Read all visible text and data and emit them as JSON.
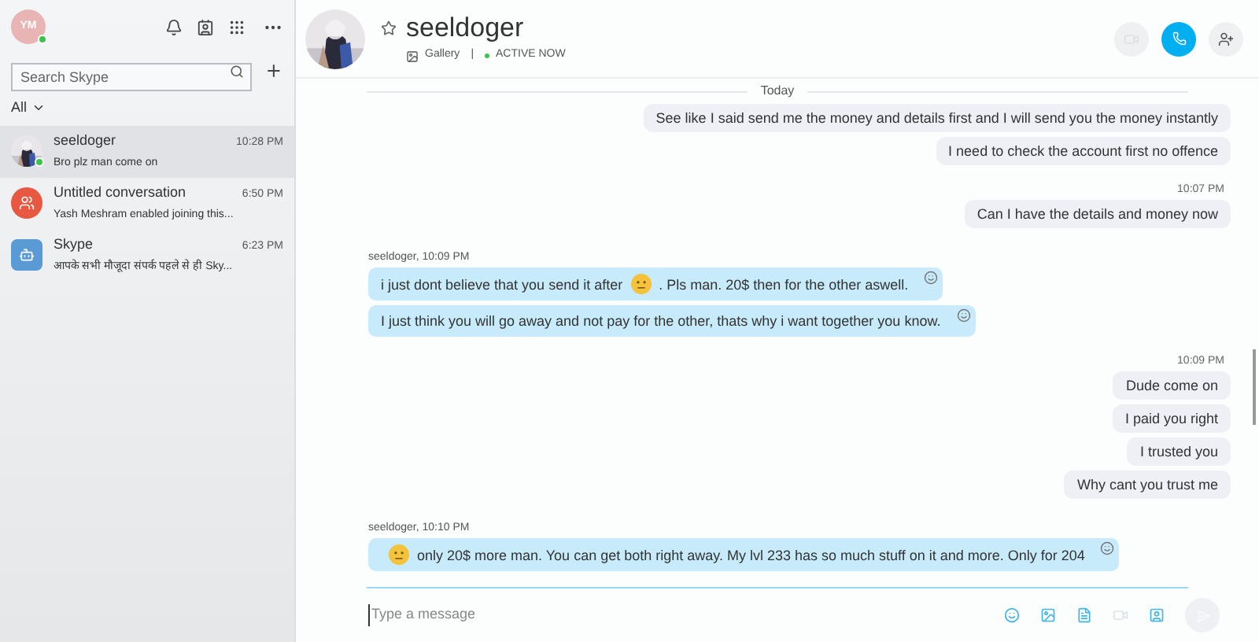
{
  "profile": {
    "initials": "YM",
    "online": true
  },
  "search": {
    "placeholder": "Search Skype"
  },
  "filter": {
    "label": "All"
  },
  "chats": [
    {
      "name": "seeldoger",
      "time": "10:28 PM",
      "preview": "Bro plz man come on",
      "kind": "picture",
      "online": true,
      "selected": true
    },
    {
      "name": "Untitled conversation",
      "time": "6:50 PM",
      "preview": "Yash Meshram enabled joining this...",
      "kind": "group",
      "color": "#e8573f",
      "online": false,
      "selected": false
    },
    {
      "name": "Skype",
      "time": "6:23 PM",
      "preview": "आपके सभी मौजूदा संपर्क पहले से ही Sky...",
      "kind": "bot",
      "color": "#5a9bd5",
      "online": false,
      "selected": false
    }
  ],
  "conversation": {
    "name": "seeldoger",
    "gallery": "Gallery",
    "separator": "|",
    "status": "ACTIVE NOW",
    "video_enabled": false
  },
  "messages": [
    {
      "kind": "date",
      "text": "Today"
    },
    {
      "kind": "outgoing",
      "text": "See like I said send me the money and details first and I will send you the money instantly"
    },
    {
      "kind": "outgoing",
      "text": "I need to check the account first no offence"
    },
    {
      "kind": "time",
      "text": "10:07 PM"
    },
    {
      "kind": "outgoing",
      "text": "Can I have the details and money now"
    },
    {
      "kind": "sender",
      "text": "seeldoger,  10:09 PM"
    },
    {
      "kind": "incoming",
      "parts": [
        {
          "kind": "text",
          "text": "i just dont believe that you send it after"
        },
        {
          "kind": "emoji"
        },
        {
          "kind": "text",
          "text": ". Pls man. 20$ then for the other aswell."
        }
      ]
    },
    {
      "kind": "incoming",
      "parts": [
        {
          "kind": "text",
          "text": "I just think you will go away and not pay for the other, thats why i want together you know."
        }
      ]
    },
    {
      "kind": "time",
      "text": "10:09 PM"
    },
    {
      "kind": "outgoing",
      "text": "Dude come on"
    },
    {
      "kind": "outgoing",
      "text": "I paid you right"
    },
    {
      "kind": "outgoing",
      "text": "I trusted you"
    },
    {
      "kind": "outgoing",
      "text": "Why cant you trust me"
    },
    {
      "kind": "sender",
      "text": "seeldoger,  10:10 PM"
    },
    {
      "kind": "incoming",
      "parts": [
        {
          "kind": "emoji"
        },
        {
          "kind": "text",
          "text": "only 20$ more man. You can get both right away. My lvl 233 has so much stuff on it and more. Only for 204"
        }
      ]
    }
  ],
  "composer": {
    "placeholder": "Type a message",
    "video_enabled": false,
    "send_enabled": false
  }
}
